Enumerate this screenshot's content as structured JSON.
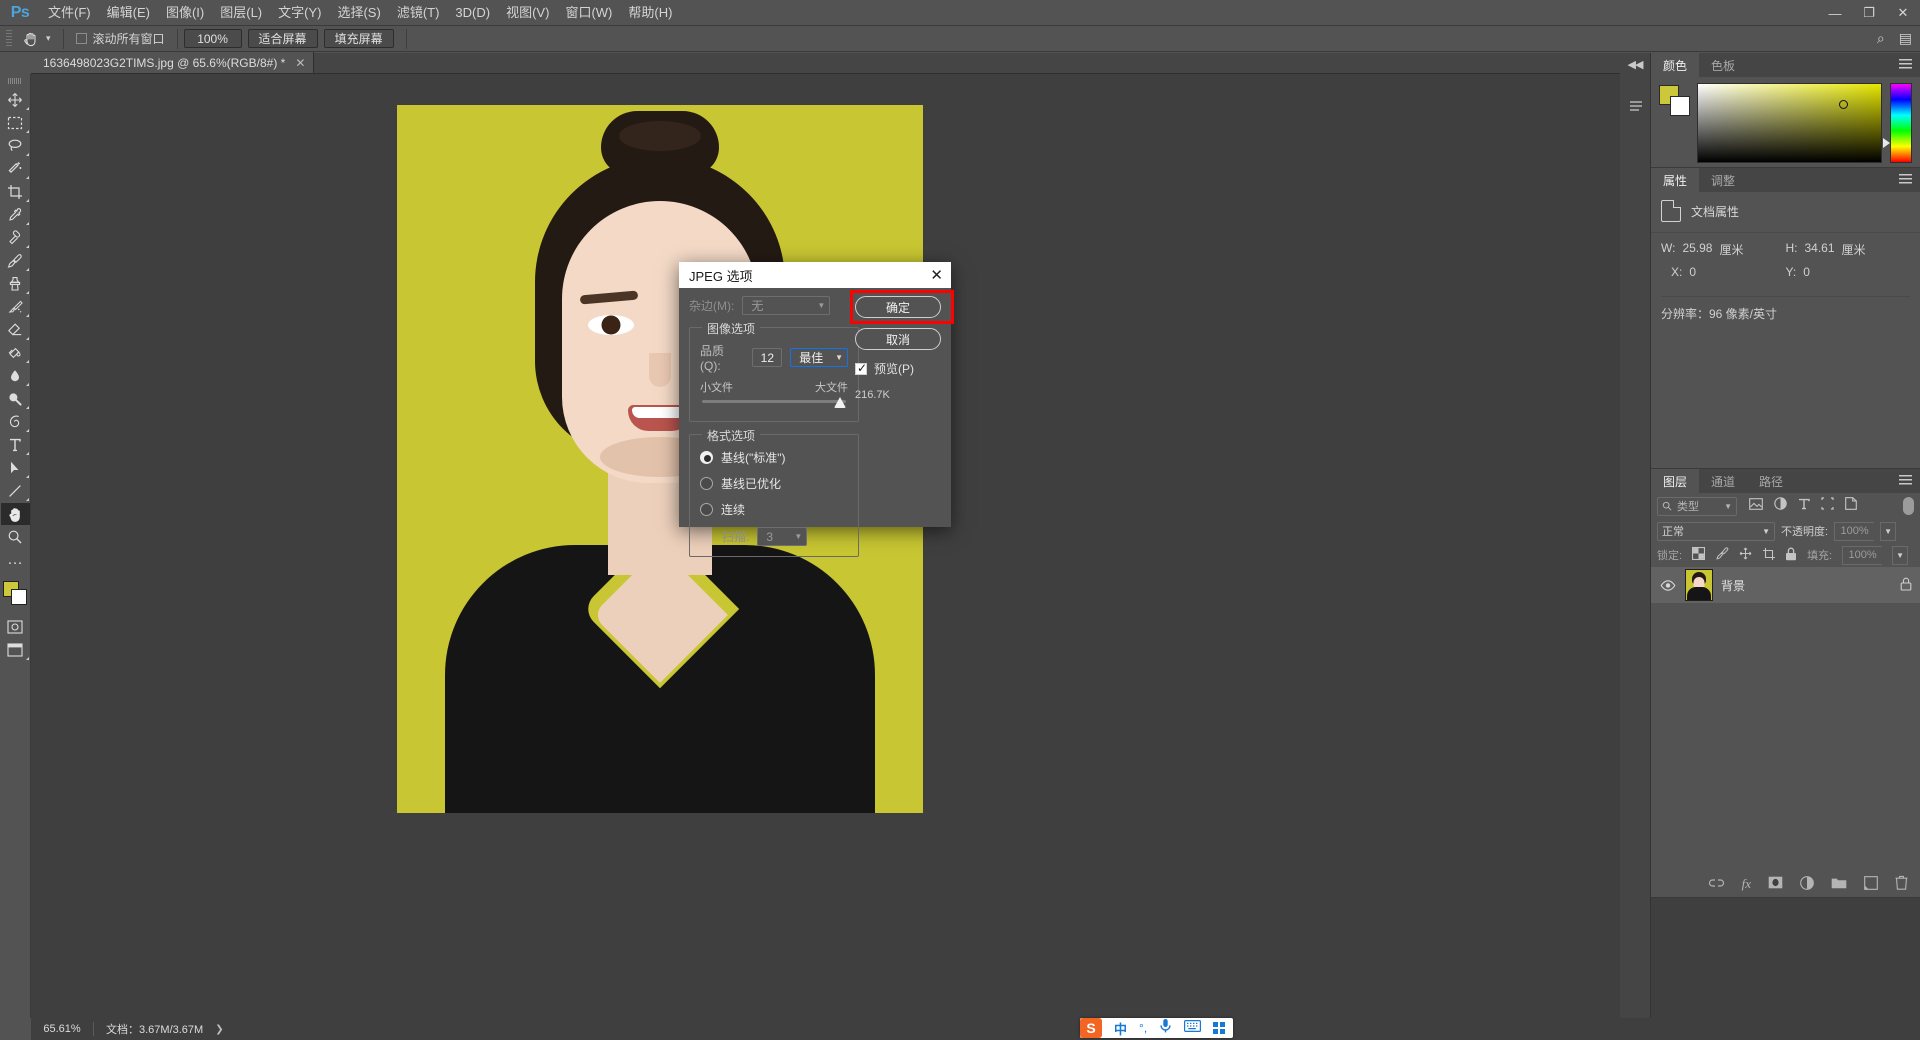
{
  "app": {
    "name": "Photoshop",
    "logo": "Ps"
  },
  "menubar": {
    "items": [
      {
        "label": "文件(F)",
        "name": "menu-file"
      },
      {
        "label": "编辑(E)",
        "name": "menu-edit"
      },
      {
        "label": "图像(I)",
        "name": "menu-image"
      },
      {
        "label": "图层(L)",
        "name": "menu-layer"
      },
      {
        "label": "文字(Y)",
        "name": "menu-type"
      },
      {
        "label": "选择(S)",
        "name": "menu-select"
      },
      {
        "label": "滤镜(T)",
        "name": "menu-filter"
      },
      {
        "label": "3D(D)",
        "name": "menu-3d"
      },
      {
        "label": "视图(V)",
        "name": "menu-view"
      },
      {
        "label": "窗口(W)",
        "name": "menu-window"
      },
      {
        "label": "帮助(H)",
        "name": "menu-help"
      }
    ],
    "window_controls": {
      "minimize": "—",
      "maximize": "❐",
      "close": "✕"
    }
  },
  "optionsbar": {
    "tool": "hand-tool",
    "scroll_all_windows": "滚动所有窗口",
    "zoom_100": "100%",
    "fit_screen": "适合屏幕",
    "fill_screen": "填充屏幕"
  },
  "document_tab": {
    "title": "1636498023G2TIMS.jpg @ 65.6%(RGB/8#) *",
    "close": "✕"
  },
  "dialog": {
    "title": "JPEG 选项",
    "close": "✕",
    "matte": {
      "label": "杂边(M):",
      "value": "无"
    },
    "image_options": {
      "group_label": "图像选项",
      "quality_label": "品质(Q):",
      "quality_value": "12",
      "quality_preset": "最佳",
      "slider_min_label": "小文件",
      "slider_max_label": "大文件"
    },
    "format_options": {
      "group_label": "格式选项",
      "options": [
        {
          "label": "基线(\"标准\")",
          "selected": true
        },
        {
          "label": "基线已优化",
          "selected": false
        },
        {
          "label": "连续",
          "selected": false
        }
      ],
      "scans_label": "扫描:",
      "scans_value": "3"
    },
    "buttons": {
      "ok": "确定",
      "cancel": "取消"
    },
    "preview": {
      "label": "预览(P)",
      "checked": true
    },
    "file_size": "216.7K",
    "highlight_color": "#ff0000"
  },
  "right_dock": {
    "color_panel": {
      "tabs": [
        {
          "label": "颜色",
          "active": true
        },
        {
          "label": "色板",
          "active": false
        }
      ],
      "foreground_color": "#ccc83a",
      "background_color": "#ffffff"
    },
    "properties_panel": {
      "tabs": [
        {
          "label": "属性",
          "active": true
        },
        {
          "label": "调整",
          "active": false
        }
      ],
      "doc_title": "文档属性",
      "width_key": "W:",
      "width_value": "25.98",
      "width_unit": "厘米",
      "height_key": "H:",
      "height_value": "34.61",
      "height_unit": "厘米",
      "x_key": "X:",
      "x_value": "0",
      "y_key": "Y:",
      "y_value": "0",
      "resolution": "分辨率：96 像素/英寸"
    },
    "layers_panel": {
      "tabs": [
        {
          "label": "图层",
          "active": true
        },
        {
          "label": "通道",
          "active": false
        },
        {
          "label": "路径",
          "active": false
        }
      ],
      "filter_type": "类型",
      "blend_mode": "正常",
      "opacity_label": "不透明度:",
      "opacity_value": "100%",
      "lock_label": "锁定:",
      "fill_label": "填充:",
      "fill_value": "100%",
      "layers": [
        {
          "name": "背景",
          "visible": true,
          "locked": true
        }
      ]
    }
  },
  "statusbar": {
    "zoom": "65.61%",
    "doc_info": "文档：3.67M/3.67M",
    "arrow": "❯"
  },
  "ime": {
    "logo": "S",
    "mode": "中",
    "punct": "°,",
    "mic": "mic-icon",
    "keyboard": "keyboard-icon",
    "apps": "apps-icon"
  },
  "toolbar": {
    "tools": [
      {
        "name": "move-tool"
      },
      {
        "name": "marquee-tool"
      },
      {
        "name": "lasso-tool"
      },
      {
        "name": "quick-selection-tool"
      },
      {
        "name": "crop-tool"
      },
      {
        "name": "eyedropper-tool"
      },
      {
        "name": "healing-brush-tool"
      },
      {
        "name": "brush-tool"
      },
      {
        "name": "clone-stamp-tool"
      },
      {
        "name": "history-brush-tool"
      },
      {
        "name": "eraser-tool"
      },
      {
        "name": "gradient-tool"
      },
      {
        "name": "blur-tool"
      },
      {
        "name": "dodge-tool"
      },
      {
        "name": "pen-tool"
      },
      {
        "name": "type-tool"
      },
      {
        "name": "path-selection-tool"
      },
      {
        "name": "line-tool"
      },
      {
        "name": "hand-tool",
        "active": true
      },
      {
        "name": "zoom-tool"
      }
    ],
    "more": "…",
    "foreground_color": "#ccc83a",
    "background_color": "#ffffff"
  }
}
